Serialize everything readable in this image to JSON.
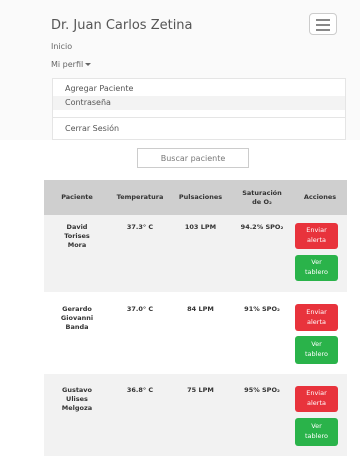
{
  "header": {
    "brand": "Dr. Juan Carlos Zetina",
    "inicio": "Inicio",
    "perfil": "Mi perfil"
  },
  "dropdown": {
    "items": [
      "Agregar Paciente",
      "Contraseña",
      "Cerrar Sesión"
    ]
  },
  "search": {
    "placeholder": "Buscar paciente"
  },
  "table": {
    "headers": {
      "paciente": "Paciente",
      "temperatura": "Temperatura",
      "pulsaciones": "Pulsaciones",
      "saturacion_line1": "Saturación",
      "saturacion_line2": "de O₂",
      "acciones": "Acciones"
    },
    "rows": [
      {
        "name": [
          "David",
          "Torises",
          "Mora"
        ],
        "temp": "37.3° C",
        "pulse": "103 LPM",
        "sat": "94.2% SPO₂",
        "alert": "Enviar alerta",
        "board": "Ver tablero"
      },
      {
        "name": [
          "Gerardo",
          "Giovanni",
          "Banda"
        ],
        "temp": "37.0° C",
        "pulse": "84 LPM",
        "sat": "91% SPO₂",
        "alert": "Enviar alerta",
        "board": "Ver tablero"
      },
      {
        "name": [
          "Gustavo",
          "Ulises",
          "Melgoza"
        ],
        "temp": "36.8° C",
        "pulse": "75 LPM",
        "sat": "95% SPO₂",
        "alert": "Enviar alerta",
        "board": "Ver tablero"
      }
    ]
  },
  "colors": {
    "alert": "#e8333c",
    "board": "#2ab34a",
    "header_bg": "#cfcfcf"
  }
}
